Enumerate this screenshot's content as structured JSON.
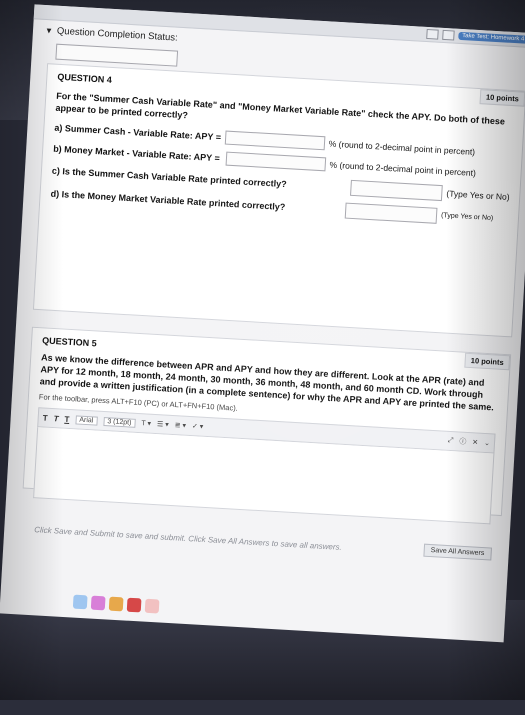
{
  "header": {
    "status_label": "Question Completion Status:",
    "window_pill": "Take Test: Homework 4"
  },
  "question4": {
    "title": "QUESTION 4",
    "points": "10 points",
    "prompt_bold1": "For the \"Summer Cash Variable Rate\" and \"Money Market Variable Rate\" check the APY. Do both of these appear to be printed correctly?",
    "a_label": "a) Summer Cash - Variable Rate: APY =",
    "a_hint": "% (round to 2-decimal point in percent)",
    "b_label": "b) Money Market - Variable Rate: APY =",
    "b_hint": "% (round to 2-decimal point in percent)",
    "c_label": "c) Is the Summer Cash Variable Rate printed correctly?",
    "c_hint": "(Type Yes or No)",
    "d_label": "d) Is the Money Market Variable Rate printed correctly?",
    "d_hint": "(Type Yes or No)"
  },
  "question5": {
    "title": "QUESTION 5",
    "points": "10 points",
    "prompt": "As we know the difference between APR and APY and how they are different. Look at the APR (rate) and APY for 12 month, 18 month, 24 month, 30 month, 36 month, 48 month, and 60 month CD. Work through and provide a written justification (in a complete sentence) for why the APR and APY are printed the same.",
    "toolbar_hint": "For the toolbar, press ALT+F10 (PC) or ALT+FN+F10 (Mac).",
    "toolbar": {
      "font": "Arial",
      "size": "3 (12pt)",
      "bold": "T",
      "italic": "T",
      "underline": "T"
    }
  },
  "footer": {
    "note": "Click Save and Submit to save and submit. Click Save All Answers to save all answers.",
    "save_all": "Save All Answers"
  },
  "colors": {
    "accent": "#4a7fc4"
  }
}
